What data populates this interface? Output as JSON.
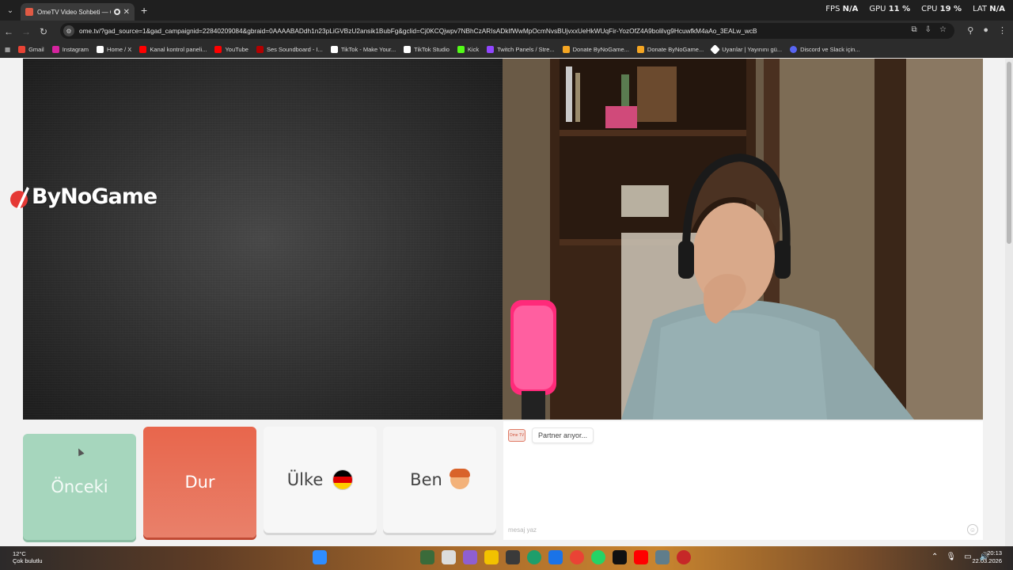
{
  "browser": {
    "tab_title": "OmeTV Video Sohbeti — O",
    "url": "ome.tv/?gad_source=1&gad_campaignid=22840209084&gbraid=0AAAABADdh1n23pLiGVBzU2ansik1BubFg&gclid=Cj0KCQjwpv7NBhCzARIsADkIfWwMpOcmNvsBUjvxxUeHkWUqFir-YozOfZ4A9bolilvg9HcuwfkM4aAo_3EALw_wcB",
    "perf": {
      "fps_label": "FPS",
      "fps_value": "N/A",
      "gpu_label": "GPU",
      "gpu_value": "11 %",
      "cpu_label": "CPU",
      "cpu_value": "19 %",
      "lat_label": "LAT",
      "lat_value": "N/A"
    },
    "bookmarks": [
      {
        "label": "Gmail",
        "color": "#ea4335"
      },
      {
        "label": "Instagram",
        "color": "#d6249f"
      },
      {
        "label": "Home / X",
        "color": "#ffffff"
      },
      {
        "label": "Kanal kontrol paneli...",
        "color": "#ff0000"
      },
      {
        "label": "YouTube",
        "color": "#ff0000"
      },
      {
        "label": "Ses Soundboard - I...",
        "color": "#b30000"
      },
      {
        "label": "TikTok - Make Your...",
        "color": "#ffffff"
      },
      {
        "label": "TikTok Studio",
        "color": "#ffffff"
      },
      {
        "label": "Kick",
        "color": "#53fc18"
      },
      {
        "label": "Twitch Panels / Stre...",
        "color": "#9146ff"
      },
      {
        "label": "Donate ByNoGame...",
        "color": "#f5a623"
      },
      {
        "label": "Donate ByNoGame...",
        "color": "#f5a623"
      },
      {
        "label": "Uyarılar | Yayınını gü...",
        "color": "#ffffff"
      },
      {
        "label": "Discord ve Slack için...",
        "color": "#5865f2"
      }
    ]
  },
  "overlay": {
    "logo_text": "ByNoGame"
  },
  "controls": {
    "prev_label": "Önceki",
    "stop_label": "Dur",
    "country_label": "Ülke",
    "me_label": "Ben"
  },
  "chat": {
    "logo_text": "Ome TV",
    "status": "Partner arıyor...",
    "input_placeholder": "mesaj yaz"
  },
  "taskbar": {
    "weather_temp": "12°C",
    "weather_desc": "Çok bulutlu",
    "time": "20:13",
    "date": "22.03.2026"
  },
  "colors": {
    "prev": "#a6d6bd",
    "stop": "#e8664c",
    "chrome_dark": "#1f1f1f"
  }
}
